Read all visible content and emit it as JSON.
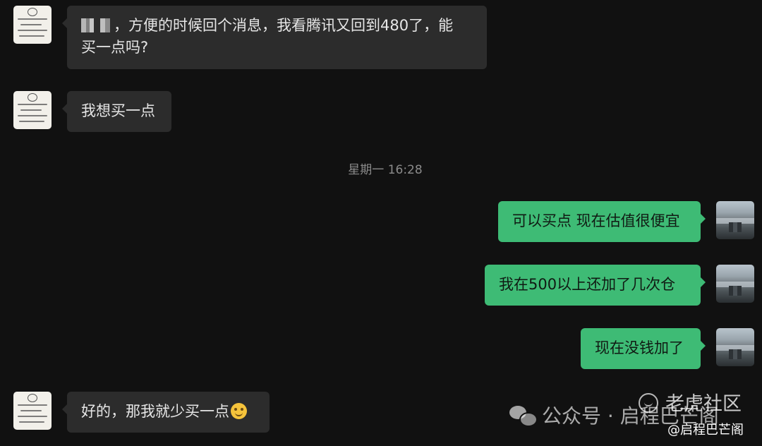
{
  "messages": [
    {
      "masked_name": "▘▝▙",
      "line1": "，方便的时候回个消息，我看腾讯又回到480了，能",
      "line2": "买一点吗?"
    },
    {
      "text": "我想买一点"
    },
    {
      "text": "可以买点 现在估值很便宜"
    },
    {
      "text": "我在500以上还加了几次仓"
    },
    {
      "text": "现在没钱加了"
    },
    {
      "text": "好的，那我就少买一点"
    }
  ],
  "timestamp": "星期一 16:28",
  "watermarks": {
    "top": "老虎社区",
    "middle": "公众号 · 启程巴芒阁",
    "bottom": "@启程巴芒阁"
  },
  "colors": {
    "background": "#111111",
    "incoming_bubble": "#2c2c2c",
    "outgoing_bubble": "#3ebb75",
    "timestamp": "#8b8b8b"
  },
  "icons": [
    "smile-emoji",
    "wechat-icon",
    "tiger-icon"
  ]
}
